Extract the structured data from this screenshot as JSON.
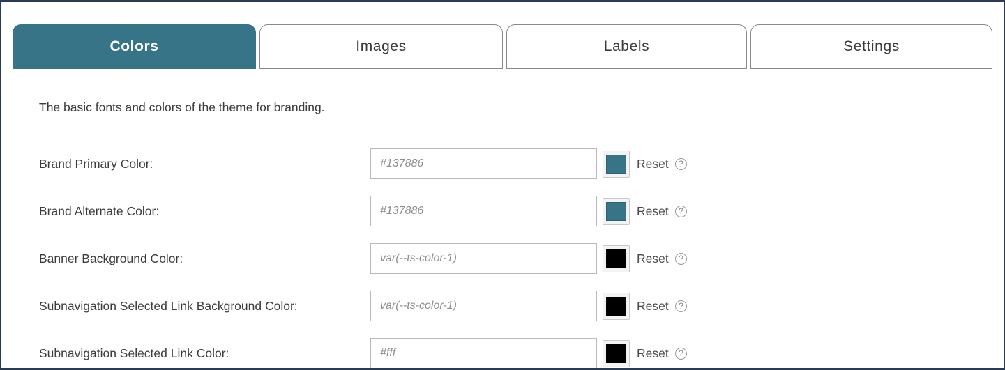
{
  "tabs": [
    {
      "label": "Colors",
      "active": true
    },
    {
      "label": "Images",
      "active": false
    },
    {
      "label": "Labels",
      "active": false
    },
    {
      "label": "Settings",
      "active": false
    }
  ],
  "panel": {
    "description": "The basic fonts and colors of the theme for branding.",
    "reset_label": "Reset",
    "help_glyph": "?",
    "accent_color": "#377487",
    "rows": [
      {
        "label": "Brand Primary Color:",
        "placeholder": "#137886",
        "value": "",
        "swatch_color": "#377487"
      },
      {
        "label": "Brand Alternate Color:",
        "placeholder": "#137886",
        "value": "",
        "swatch_color": "#377487"
      },
      {
        "label": "Banner Background Color:",
        "placeholder": "var(--ts-color-1)",
        "value": "",
        "swatch_color": "#000000"
      },
      {
        "label": "Subnavigation Selected Link Background Color:",
        "placeholder": "var(--ts-color-1)",
        "value": "",
        "swatch_color": "#000000"
      },
      {
        "label": "Subnavigation Selected Link Color:",
        "placeholder": "#fff",
        "value": "",
        "swatch_color": "#000000"
      }
    ]
  }
}
